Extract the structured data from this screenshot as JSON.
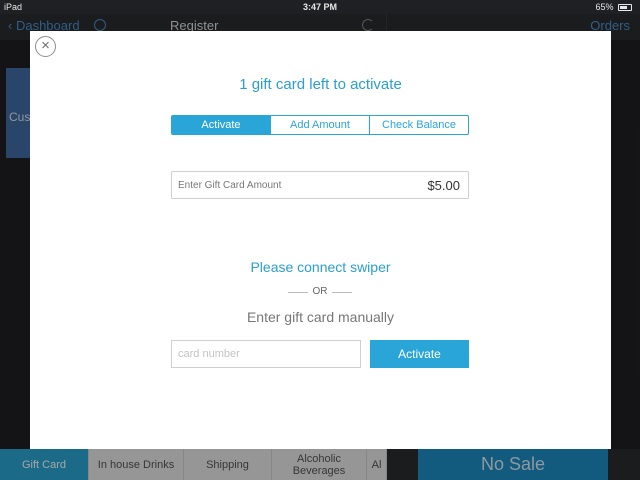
{
  "status_bar": {
    "device": "iPad",
    "time": "3:47 PM",
    "battery": "65%"
  },
  "background": {
    "back_label": "Dashboard",
    "title": "Register",
    "orders_label": "Orders",
    "tile_label": "Cus",
    "bottom_tabs": [
      {
        "label": "Gift Card",
        "active": true
      },
      {
        "label": "In house Drinks",
        "active": false
      },
      {
        "label": "Shipping",
        "active": false
      },
      {
        "label": "Alcoholic Beverages",
        "active": false
      },
      {
        "label": "Al",
        "active": false
      }
    ],
    "no_sale_label": "No Sale"
  },
  "modal": {
    "close_icon": "close-icon",
    "title": "1 gift card left to activate",
    "tabs": [
      {
        "label": "Activate",
        "active": true
      },
      {
        "label": "Add Amount",
        "active": false
      },
      {
        "label": "Check Balance",
        "active": false
      }
    ],
    "amount_label": "Enter Gift Card Amount",
    "amount_value": "$5.00",
    "swiper_text": "Please connect swiper",
    "or_text": "OR",
    "manual_text": "Enter gift card manually",
    "card_placeholder": "card number",
    "activate_button": "Activate"
  },
  "colors": {
    "accent": "#2aa5d8",
    "title_blue": "#2a9fd0"
  }
}
